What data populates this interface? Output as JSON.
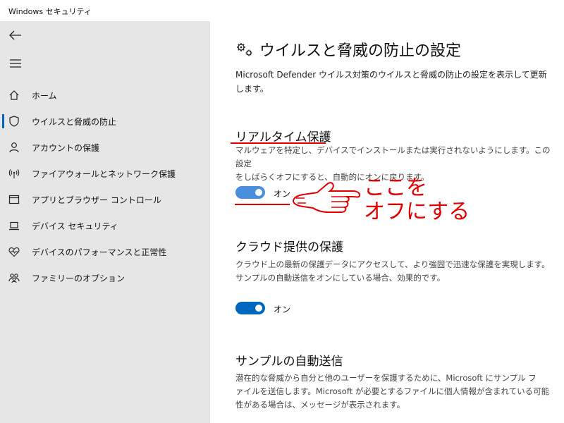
{
  "window": {
    "title": "Windows セキュリティ"
  },
  "sidebar": {
    "items": [
      {
        "label": "ホーム",
        "icon": "home-icon"
      },
      {
        "label": "ウイルスと脅威の防止",
        "icon": "shield-icon",
        "selected": true
      },
      {
        "label": "アカウントの保護",
        "icon": "person-icon"
      },
      {
        "label": "ファイアウォールとネットワーク保護",
        "icon": "wireless-icon"
      },
      {
        "label": "アプリとブラウザー コントロール",
        "icon": "app-window-icon"
      },
      {
        "label": "デバイス セキュリティ",
        "icon": "laptop-icon"
      },
      {
        "label": "デバイスのパフォーマンスと正常性",
        "icon": "heart-pulse-icon"
      },
      {
        "label": "ファミリーのオプション",
        "icon": "family-icon"
      }
    ]
  },
  "main": {
    "title": "ウイルスと脅威の防止の設定",
    "description_line1": "Microsoft Defender ウイルス対策のウイルスと脅威の防止の設定を表示して更新",
    "description_line2": "します。",
    "sections": [
      {
        "title": "リアルタイム保護",
        "desc_line1": "マルウェアを特定し、デバイスでインストールまたは実行されないようにします。この設定",
        "desc_line2": "をしばらくオフにすると、自動的にオンに戻ります。",
        "toggle_state": "オン",
        "toggle_on": true
      },
      {
        "title": "クラウド提供の保護",
        "desc_line1": "クラウド上の最新の保護データにアクセスして、より強固で迅速な保護を実現します。",
        "desc_line2": "サンプルの自動送信をオンにしている場合、効果的です。",
        "toggle_state": "オン",
        "toggle_on": true
      },
      {
        "title": "サンプルの自動送信",
        "desc_line1": "潜在的な脅威から自分と他のユーザーを保護するために、Microsoft にサンプル フ",
        "desc_line2": "ァイルを送信します。Microsoft が必要とするファイルに個人情報が含まれている可能",
        "desc_line3": "性がある場合は、メッセージが表示されます。"
      }
    ]
  },
  "annotation": {
    "line1": "ここを",
    "line2": "オフにする",
    "color": "#e50000"
  },
  "colors": {
    "accent": "#0067c0",
    "sidebar_bg": "#e6e6e6"
  }
}
